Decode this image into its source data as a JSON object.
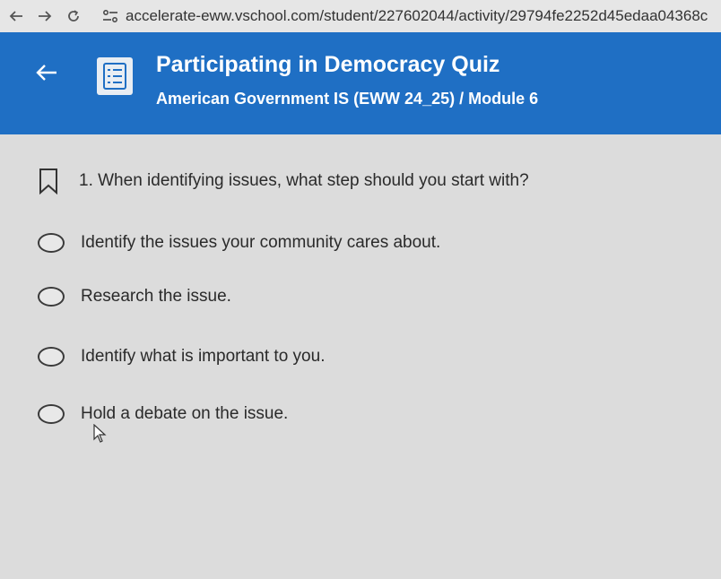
{
  "browser": {
    "url": "accelerate-eww.vschool.com/student/227602044/activity/29794fe2252d45edaa04368c"
  },
  "header": {
    "title": "Participating in Democracy Quiz",
    "subtitle": "American Government IS (EWW 24_25) / Module 6"
  },
  "question": {
    "text": "1. When identifying issues, what step should you start with?",
    "options": [
      "Identify the issues your community cares about.",
      "Research the issue.",
      "Identify what is important to you.",
      "Hold a debate on the issue."
    ]
  },
  "colors": {
    "header_bg": "#1f6fc4",
    "page_bg": "#dcdcdc"
  }
}
